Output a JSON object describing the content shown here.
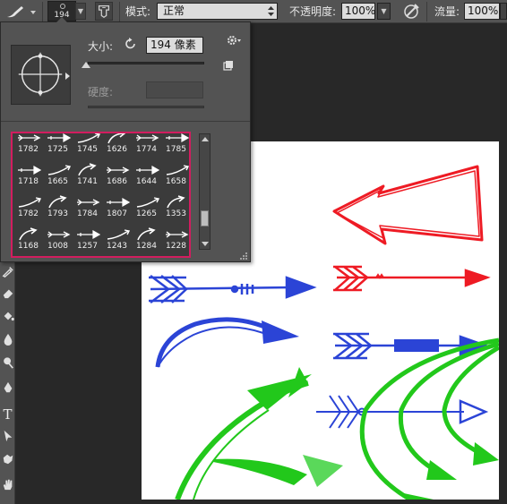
{
  "options_bar": {
    "brush_tool_icon": "brush-icon",
    "preset_size": "194",
    "mode_label": "模式:",
    "mode_value": "正常",
    "opacity_label": "不透明度:",
    "opacity_value": "100%",
    "flow_label": "流量:",
    "flow_value": "100%"
  },
  "brush_popup": {
    "size_label": "大小:",
    "size_value": "194 像素",
    "hardness_label": "硬度:",
    "brushes": [
      [
        "1782",
        "1725",
        "1745",
        "1626",
        "1774",
        "1785"
      ],
      [
        "1718",
        "1665",
        "1741",
        "1686",
        "1644",
        "1658"
      ],
      [
        "1782",
        "1793",
        "1784",
        "1807",
        "1265",
        "1353"
      ],
      [
        "1168",
        "1008",
        "1257",
        "1243",
        "1284",
        "1228"
      ]
    ]
  },
  "tools": [
    "history-brush-icon",
    "eraser-icon",
    "paint-bucket-icon",
    "blur-icon",
    "dodge-icon",
    "pen-icon",
    "type-icon",
    "path-select-icon",
    "custom-shape-icon",
    "hand-icon"
  ],
  "colors": {
    "panel": "#535353",
    "workspace": "#282828",
    "highlight": "#d21d5f",
    "arrow_red": "#ee1b24",
    "arrow_blue": "#2b44d6",
    "arrow_green": "#22c81b"
  }
}
